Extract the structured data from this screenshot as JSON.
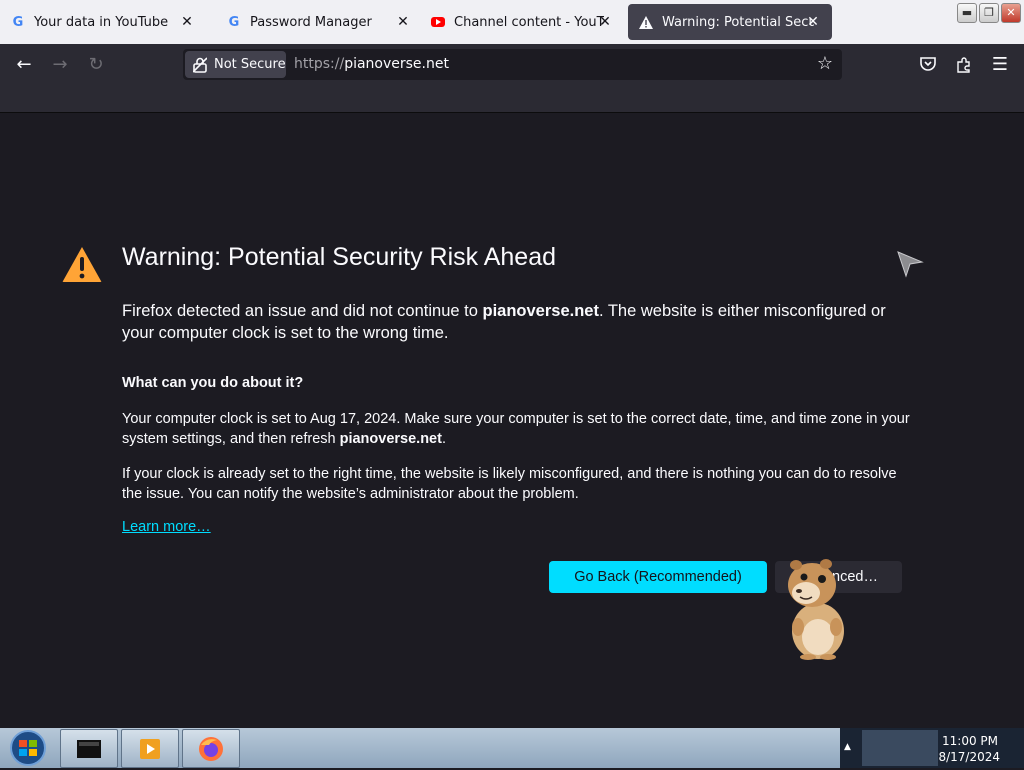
{
  "tabs": [
    {
      "label": "Your data in YouTube",
      "favicon": "google-icon"
    },
    {
      "label": "Password Manager",
      "favicon": "google-icon"
    },
    {
      "label": "Channel content - YouTube",
      "favicon": "youtube-icon"
    },
    {
      "label": "Warning: Potential Security R",
      "favicon": "warning-icon",
      "active": true
    }
  ],
  "nav": {
    "not_secure_label": "Not Secure",
    "url_protocol": "https://",
    "url_host": "pianoverse.net"
  },
  "page": {
    "title": "Warning: Potential Security Risk Ahead",
    "para1_prefix": "Firefox detected an issue and did not continue to ",
    "para1_host": "pianoverse.net",
    "para1_suffix": ". The website is either misconfigured or your computer clock is set to the wrong time.",
    "subhead": "What can you do about it?",
    "para2_prefix": "Your computer clock is set to Aug 17, 2024. Make sure your computer is set to the correct date, time, and time zone in your system settings, and then refresh ",
    "para2_host": "pianoverse.net",
    "para2_suffix": ".",
    "para3": "If your clock is already set to the right time, the website is likely misconfigured, and there is nothing you can do to resolve the issue. You can notify the website’s administrator about the problem.",
    "learn_more": "Learn more…",
    "go_back_label": "Go Back (Recommended)",
    "advanced_label": "Advanced…"
  },
  "taskbar": {
    "time": "11:00 PM",
    "date": "8/17/2024"
  },
  "colors": {
    "accent": "#00ddff",
    "warning": "#ffa436",
    "background": "#1c1b22"
  }
}
